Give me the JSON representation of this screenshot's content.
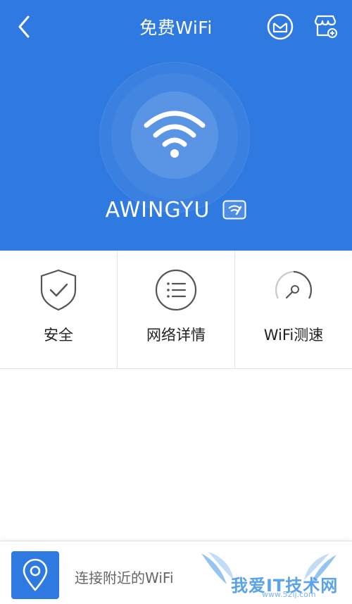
{
  "header": {
    "title": "免费WiFi",
    "back_icon": "chevron-left-icon",
    "mail_icon": "mail-icon",
    "store_icon": "store-add-icon"
  },
  "network": {
    "ssid": "AWINGYU",
    "status_icon": "wifi-icon",
    "badge_icon": "edit-badge-icon"
  },
  "tools": [
    {
      "label": "安全",
      "icon": "shield-check-icon"
    },
    {
      "label": "网络详情",
      "icon": "list-icon"
    },
    {
      "label": "WiFi测速",
      "icon": "speed-gauge-icon"
    }
  ],
  "bottom": {
    "connect_label": "连接附近的WiFi",
    "icon": "location-pin-icon"
  },
  "watermark": {
    "text": "我爱IT技术网",
    "url": "www.52ij.com"
  },
  "colors": {
    "primary": "#2f7ae0",
    "background": "#ffffff",
    "divider": "#e3e3e3",
    "text": "#222222",
    "icon_gray": "#555555"
  }
}
